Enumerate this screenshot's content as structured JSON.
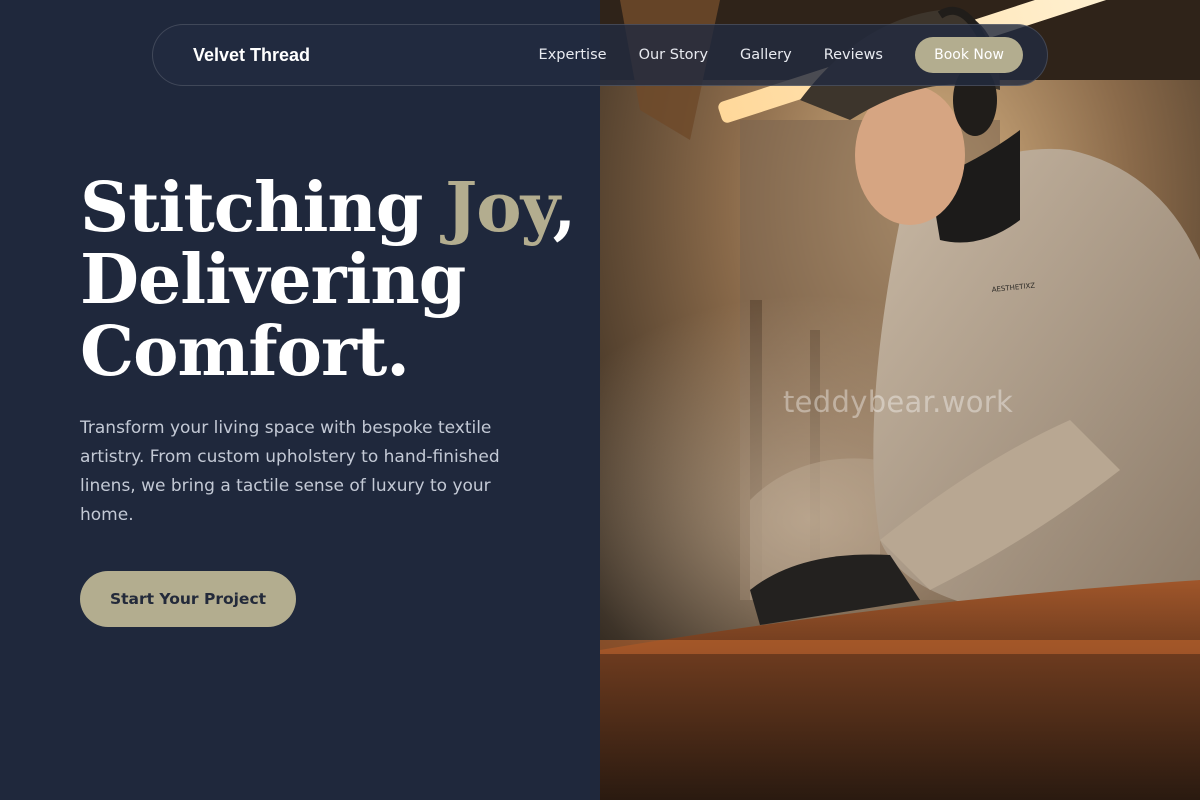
{
  "nav": {
    "brand": "Velvet Thread",
    "links": [
      "Expertise",
      "Our Story",
      "Gallery",
      "Reviews"
    ],
    "cta": "Book Now"
  },
  "hero": {
    "title_part1": "Stitching ",
    "title_accent": "Joy",
    "title_comma": ",",
    "title_line2": "Delivering",
    "title_line3": "Comfort.",
    "description": "Transform your living space with bespoke textile artistry. From custom upholstery to hand-finished linens, we bring a tactile sense of luxury to your home.",
    "cta": "Start Your Project"
  },
  "photo": {
    "watermark": "teddybear.work",
    "sweater_text": "AESTHETIXZ"
  },
  "colors": {
    "background": "#1f283c",
    "accent": "#b3ad8f",
    "text": "#ffffff",
    "muted_text": "#c3c9d5"
  }
}
